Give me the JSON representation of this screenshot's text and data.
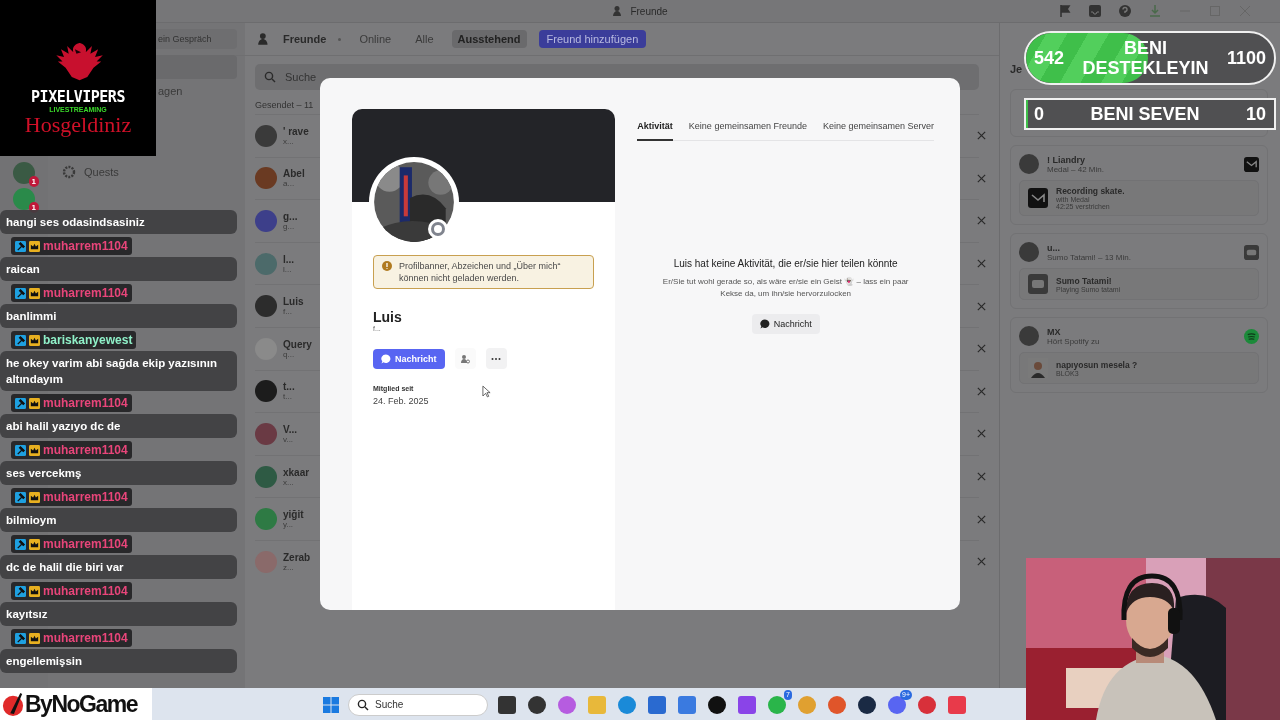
{
  "window": {
    "title": "Freunde"
  },
  "server_rail": {
    "badges": [
      "1",
      "1"
    ]
  },
  "sidebar": {
    "search_button": "ein Gespräch",
    "items": [
      {
        "label": "agen",
        "kind": "plain"
      },
      {
        "label": "Quests",
        "kind": "quests"
      }
    ]
  },
  "friends_header": {
    "title": "Freunde",
    "tabs": [
      {
        "label": "Online",
        "selected": false
      },
      {
        "label": "Alle",
        "selected": false
      },
      {
        "label": "Ausstehend",
        "selected": true
      }
    ],
    "add_button": "Freund hinzufügen"
  },
  "search": {
    "placeholder": "Suche"
  },
  "pending": {
    "heading": "Gesendet – 11",
    "rows": [
      {
        "name": "' rave",
        "sub": "x...",
        "color": "#3a3a3a"
      },
      {
        "name": "Abel",
        "sub": "a...",
        "color": "#6a3a22"
      },
      {
        "name": "g...",
        "sub": "g...",
        "color": "#3d3f8a"
      },
      {
        "name": "l...",
        "sub": "l...",
        "color": "#4c6a6a"
      },
      {
        "name": "Luis",
        "sub": "f...",
        "color": "#2c2c2c"
      },
      {
        "name": "Query",
        "sub": "q...",
        "color": "#8a8a8a"
      },
      {
        "name": "t...",
        "sub": "t...",
        "color": "#1c1c1c"
      },
      {
        "name": "V...",
        "sub": "v...",
        "color": "#6a3a44"
      },
      {
        "name": "xkaar",
        "sub": "x...",
        "color": "#2e5a44"
      },
      {
        "name": "yiğit",
        "sub": "y...",
        "color": "#2e7a44"
      },
      {
        "name": "Zerab",
        "sub": "z...",
        "color": "#8a6a6a"
      }
    ]
  },
  "active_now": {
    "heading": "Je",
    "cards": [
      {
        "name": "! Liandry",
        "status": "Medal – 42 Min.",
        "title": "Recording skate.",
        "lines": [
          "with Medal",
          "42:25 verstrichen"
        ],
        "kind": "medal"
      },
      {
        "name": "u...",
        "status": "Sumo Tatami! – 13 Min.",
        "title": "Sumo Tatami!",
        "lines": [
          "Playing Sumo tatami"
        ],
        "kind": "game"
      },
      {
        "name": "MX",
        "status": "Hört Spotify zu",
        "title": "napıyosun mesela ?",
        "lines": [
          "BLOK3"
        ],
        "kind": "spotify"
      }
    ]
  },
  "profile": {
    "name": "Luis",
    "username": "f...",
    "notice": "Profilbanner, Abzeichen und „Über mich“ können nicht geladen werden.",
    "message_button": "Nachricht",
    "member_since_label": "Mitglied seit",
    "member_since": "24. Feb. 2025",
    "tabs": [
      {
        "label": "Aktivität",
        "selected": true
      },
      {
        "label": "Keine gemeinsamen Freunde",
        "selected": false
      },
      {
        "label": "Keine gemeinsamen Server",
        "selected": false
      }
    ],
    "empty_title": "Luis hat keine Aktivität, die er/sie hier teilen könnte",
    "empty_text": "Er/Sie tut wohl gerade so, als wäre er/sie ein Geist 👻 – lass ein paar Kekse da, um ihn/sie hervorzulocken",
    "empty_button": "Nachricht"
  },
  "stream_logo": {
    "name": "PIXELVIPERS",
    "tagline": "LIVESTREAMING",
    "greeting": "Hosgeldiniz"
  },
  "goals": [
    {
      "current": "542",
      "label": "BENI DESTEKLEYIN",
      "target": "1100",
      "level": 0.49
    },
    {
      "current": "0",
      "label": "BENI SEVEN",
      "target": "10",
      "level": 0
    }
  ],
  "chat": [
    {
      "text": "hangi ses odasindsasiniz"
    },
    {
      "user": "muharrem1104",
      "color": "#e8457a",
      "text": "raican"
    },
    {
      "user": "muharrem1104",
      "color": "#e8457a",
      "text": "banlimmi"
    },
    {
      "user": "bariskanyewest",
      "color": "#8ff0c8",
      "text": "he okey varim abi sağda ekip yazısının altındayım"
    },
    {
      "user": "muharrem1104",
      "color": "#e8457a",
      "text": "abi halil yazıyo dc de"
    },
    {
      "user": "muharrem1104",
      "color": "#e8457a",
      "text": "ses vercekmş"
    },
    {
      "user": "muharrem1104",
      "color": "#e8457a",
      "text": "bilmioym"
    },
    {
      "user": "muharrem1104",
      "color": "#e8457a",
      "text": "dc de halil die biri var"
    },
    {
      "user": "muharrem1104",
      "color": "#e8457a",
      "text": "kayıtsız"
    },
    {
      "user": "muharrem1104",
      "color": "#e8457a",
      "text": "engellemişsin"
    }
  ],
  "sponsor": {
    "name": "ByNoGame"
  },
  "taskbar": {
    "search": {
      "placeholder": "Suche"
    },
    "badges": [
      "7",
      "9+"
    ]
  }
}
